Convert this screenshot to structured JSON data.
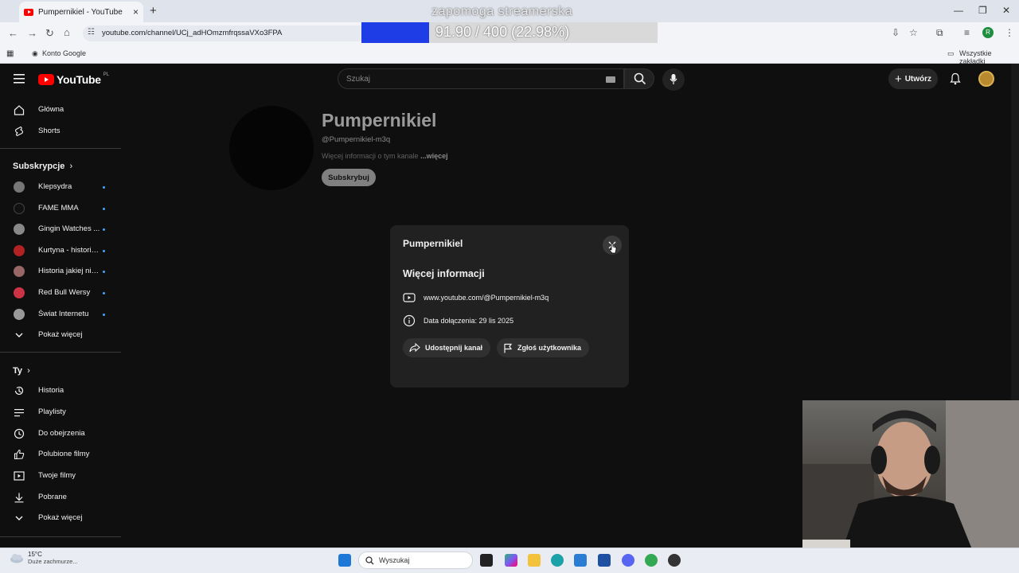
{
  "browser": {
    "tab_title": "Pumpernikiel - YouTube",
    "tab_close": "×",
    "new_tab": "+",
    "url": "youtube.com/channel/UCj_adHOmzmfrqssaVXo3FPA",
    "bookmark_google": "Konto Google",
    "all_bookmarks": "Wszystkie zakładki",
    "profile_letter": "R"
  },
  "overlay": {
    "title": "zapomoga streamerska",
    "progress_text": "91.90 / 400 (22.98%)",
    "progress_fraction": 0.2298,
    "fill_color": "#1f3de6"
  },
  "youtube": {
    "logo_text": "YouTube",
    "country_code": "PL",
    "search_placeholder": "Szukaj",
    "create_label": "Utwórz"
  },
  "sidebar": {
    "main": [
      {
        "label": "Główna",
        "icon": "home-icon"
      },
      {
        "label": "Shorts",
        "icon": "shorts-icon"
      }
    ],
    "subscriptions_header": "Subskrypcje",
    "subscriptions": [
      {
        "label": "Klepsydra",
        "color": "#777777"
      },
      {
        "label": "FAME MMA",
        "color": "#111111"
      },
      {
        "label": "Gingin Watches ...",
        "color": "#888888"
      },
      {
        "label": "Kurtyna - historie...",
        "color": "#b22222"
      },
      {
        "label": "Historia jakiej nie...",
        "color": "#996666"
      },
      {
        "label": "Red Bull Wersy",
        "color": "#cc3344"
      },
      {
        "label": "Świat Internetu",
        "color": "#999999"
      }
    ],
    "show_more_1": "Pokaż więcej",
    "you_header": "Ty",
    "you_items": [
      {
        "label": "Historia",
        "icon": "history-icon"
      },
      {
        "label": "Playlisty",
        "icon": "playlist-icon"
      },
      {
        "label": "Do obejrzenia",
        "icon": "clock-icon"
      },
      {
        "label": "Polubione filmy",
        "icon": "thumb-up-icon"
      },
      {
        "label": "Twoje filmy",
        "icon": "video-icon"
      },
      {
        "label": "Pobrane",
        "icon": "download-icon"
      }
    ],
    "show_more_2": "Pokaż więcej"
  },
  "channel": {
    "name": "Pumpernikiel",
    "handle": "@Pumpernikiel-m3q",
    "description": "Więcej informacji o tym kanale",
    "more": "...więcej",
    "subscribe": "Subskrybuj"
  },
  "modal": {
    "title": "Pumpernikiel",
    "section_title": "Więcej informacji",
    "channel_url": "www.youtube.com/@Pumpernikiel-m3q",
    "joined": "Data dołączenia: 29 lis 2025",
    "share_button": "Udostępnij kanał",
    "report_button": "Zgłoś użytkownika"
  },
  "taskbar": {
    "temperature": "15°C",
    "weather_desc": "Duże zachmurze...",
    "search_placeholder": "Wyszukaj"
  }
}
